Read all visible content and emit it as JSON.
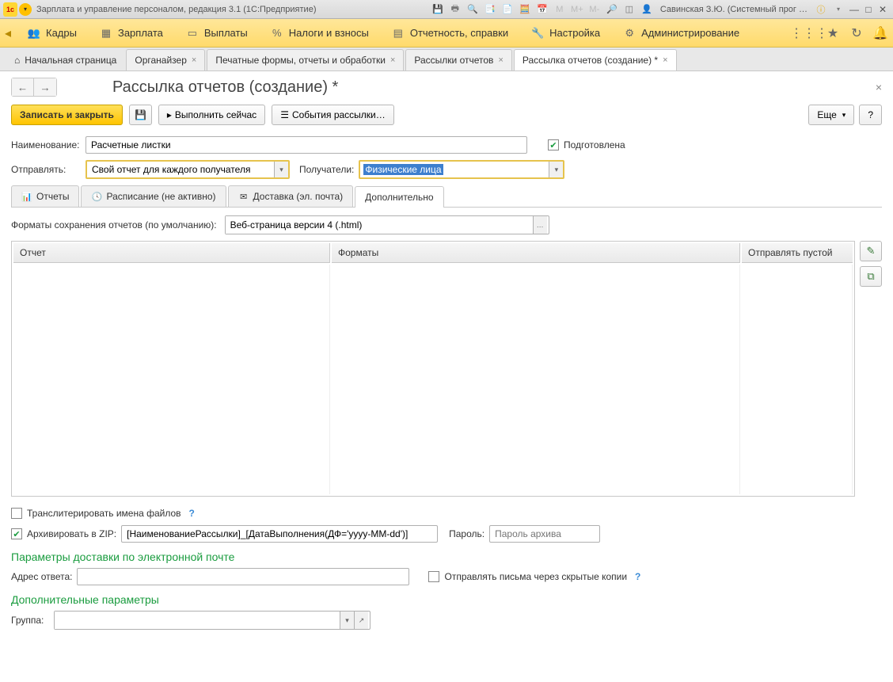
{
  "titlebar": {
    "app_title": "Зарплата и управление персоналом, редакция 3.1  (1С:Предприятие)",
    "user": "Савинская З.Ю. (Системный прог …"
  },
  "mainmenu": {
    "items": [
      "Кадры",
      "Зарплата",
      "Выплаты",
      "Налоги и взносы",
      "Отчетность, справки",
      "Настройка",
      "Администрирование"
    ]
  },
  "tabs": {
    "home": "Начальная страница",
    "items": [
      {
        "label": "Органайзер"
      },
      {
        "label": "Печатные формы, отчеты и обработки"
      },
      {
        "label": "Рассылки отчетов"
      },
      {
        "label": "Рассылка отчетов (создание) *",
        "active": true
      }
    ]
  },
  "page": {
    "title": "Рассылка отчетов (создание) *",
    "save_close": "Записать и закрыть",
    "run_now": "Выполнить сейчас",
    "events": "События рассылки…",
    "more": "Еще",
    "help": "?"
  },
  "form": {
    "name_label": "Наименование:",
    "name_value": "Расчетные листки",
    "prepared_label": "Подготовлена",
    "send_label": "Отправлять:",
    "send_value": "Свой отчет для каждого получателя",
    "recipients_label": "Получатели:",
    "recipients_value": "Физические лица"
  },
  "subtabs": {
    "reports": "Отчеты",
    "schedule": "Расписание (не активно)",
    "delivery": "Доставка (эл. почта)",
    "additional": "Дополнительно"
  },
  "additional": {
    "formats_label": "Форматы сохранения отчетов (по умолчанию):",
    "formats_value": "Веб-страница версии 4 (.html)",
    "table": {
      "col1": "Отчет",
      "col2": "Форматы",
      "col3": "Отправлять пустой"
    },
    "translit_label": "Транслитерировать имена файлов",
    "zip_label": "Архивировать в ZIP:",
    "zip_value": "[НаименованиеРассылки]_[ДатаВыполнения(ДФ='yyyy-MM-dd')]",
    "password_label": "Пароль:",
    "password_placeholder": "Пароль архива",
    "email_section": "Параметры доставки по электронной почте",
    "reply_label": "Адрес ответа:",
    "bcc_label": "Отправлять письма через скрытые копии",
    "extra_section": "Дополнительные параметры",
    "group_label": "Группа:"
  }
}
